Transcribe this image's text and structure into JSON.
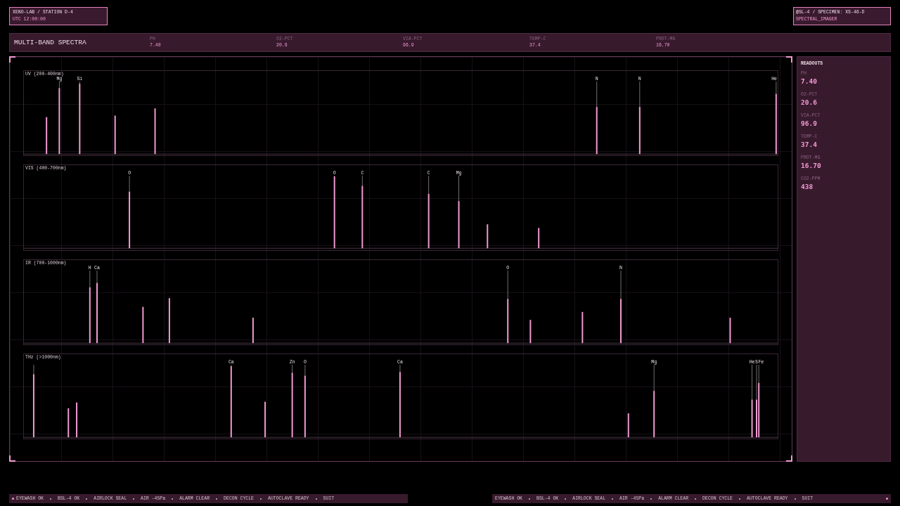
{
  "station_card": {
    "title": "XENO-LAB / STATION D-4",
    "time": "UTC 12:00:00"
  },
  "specimen_card": {
    "title": "@SL-4 / SPECIMEN: XS-46-D",
    "instrument": "SPECTRAL_IMAGER"
  },
  "header": {
    "title": "MULTI-BAND SPECTRA",
    "metrics": [
      {
        "label": "PH",
        "value": "7.40"
      },
      {
        "label": "O2-PCT",
        "value": "20.6"
      },
      {
        "label": "VIA-PCT",
        "value": "96.9"
      },
      {
        "label": "TEMP-C",
        "value": "37.4"
      },
      {
        "label": "PROT-MG",
        "value": "16.70"
      }
    ]
  },
  "spectra": [
    {
      "title": "UV (200-400nm)",
      "peak_labels": [
        "Mg",
        "Si",
        "N",
        "N",
        "He"
      ]
    },
    {
      "title": "VIS (400-700nm)",
      "peak_labels": [
        "O",
        "O",
        "C",
        "C",
        "Mg"
      ]
    },
    {
      "title": "IR (700-1000nm)",
      "peak_labels": [
        "H",
        "Ca",
        "O",
        "N"
      ]
    },
    {
      "title": "THz (>1000nm)",
      "peak_labels": [
        "Ca",
        "Zn",
        "O",
        "Ca",
        "Mg",
        "He",
        "S",
        "Fe"
      ]
    }
  ],
  "readouts": {
    "title": "READOUTS",
    "items": [
      {
        "label": "PH",
        "value": "7.40"
      },
      {
        "label": "O2-PCT",
        "value": "20.6"
      },
      {
        "label": "VIA-PCT",
        "value": "96.9"
      },
      {
        "label": "TEMP-C",
        "value": "37.4"
      },
      {
        "label": "PROT-MG",
        "value": "16.70"
      },
      {
        "label": "CO2-PPM",
        "value": "438"
      }
    ]
  },
  "status_tickers": [
    {
      "led_first": true,
      "items": [
        "EYEWASH OK",
        "BSL-4 OK",
        "AIRLOCK SEAL",
        "AIR -45Pa",
        "ALARM CLEAR",
        "DECON CYCLE",
        "AUTOCLAVE READY",
        "SUIT"
      ]
    },
    {
      "led_last": true,
      "items": [
        "EYEWASH OK",
        "BSL-4 OK",
        "AIRLOCK SEAL",
        "AIR -45Pa",
        "ALARM CLEAR",
        "DECON CYCLE",
        "AUTOCLAVE READY",
        "SUIT"
      ]
    }
  ]
}
